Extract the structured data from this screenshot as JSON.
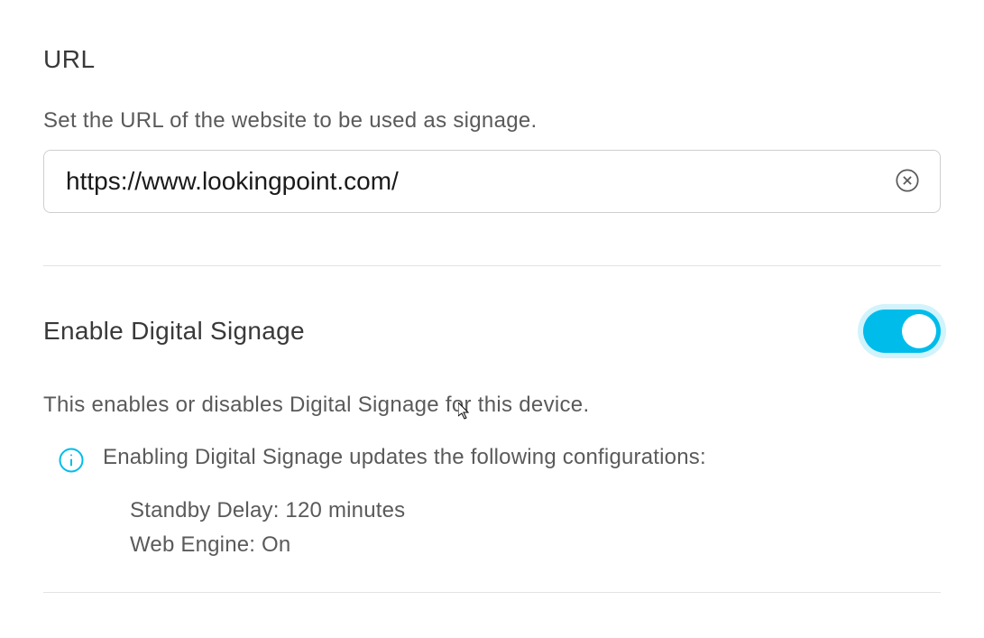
{
  "url_section": {
    "title": "URL",
    "description": "Set the URL of the website to be used as signage.",
    "input_value": "https://www.lookingpoint.com/"
  },
  "signage_section": {
    "toggle_label": "Enable Digital Signage",
    "toggle_on": true,
    "description": "This enables or disables Digital Signage for this device.",
    "info_title": "Enabling Digital Signage updates the following configurations:",
    "standby_line": "Standby Delay: 120 minutes",
    "webengine_line": "Web Engine: On"
  }
}
